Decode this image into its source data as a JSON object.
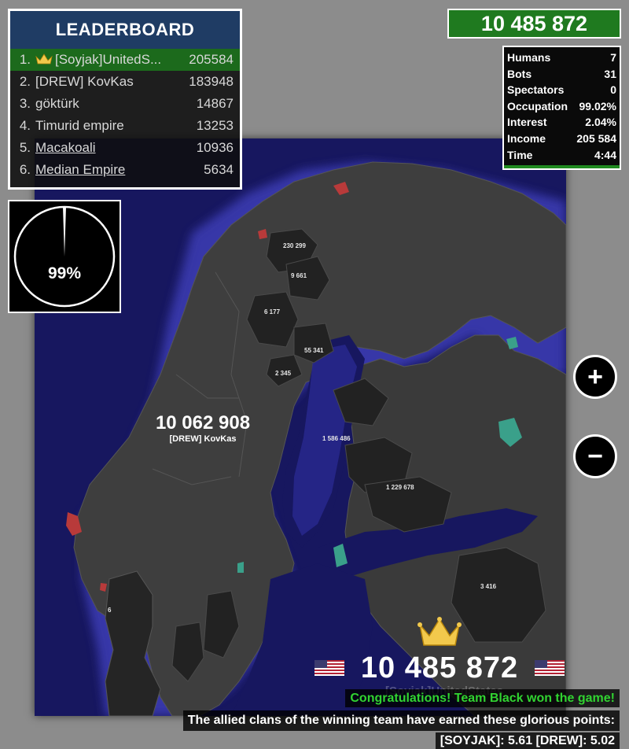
{
  "leaderboard": {
    "title": "LEADERBOARD",
    "rows": [
      {
        "rank": "1.",
        "name": "[Soyjak]UnitedS...",
        "score": "205584"
      },
      {
        "rank": "2.",
        "name": "[DREW] KovKas",
        "score": "183948"
      },
      {
        "rank": "3.",
        "name": "göktürk",
        "score": "14867"
      },
      {
        "rank": "4.",
        "name": "Timurid empire",
        "score": "13253"
      },
      {
        "rank": "5.",
        "name": "Macakoali",
        "score": "10936"
      },
      {
        "rank": "6.",
        "name": "Median Empire",
        "score": "5634"
      }
    ]
  },
  "occupation_pie": {
    "label": "99%",
    "fraction": 0.99
  },
  "total_score": "10 485 872",
  "stats": [
    {
      "label": "Humans",
      "value": "7"
    },
    {
      "label": "Bots",
      "value": "31"
    },
    {
      "label": "Spectators",
      "value": "0"
    },
    {
      "label": "Occupation",
      "value": "99.02%"
    },
    {
      "label": "Interest",
      "value": "2.04%"
    },
    {
      "label": "Income",
      "value": "205 584"
    },
    {
      "label": "Time",
      "value": "4:44"
    }
  ],
  "zoom": {
    "in_label": "+",
    "out_label": "−"
  },
  "map": {
    "territory_labels": [
      "230 299",
      "9 661",
      "6 177",
      "55 341",
      "2 345",
      "1 586 486",
      "1 229 678",
      "3 416",
      "6"
    ],
    "player_territory": {
      "score": "10 062 908",
      "name": "[DREW] KovKas"
    }
  },
  "winner": {
    "score": "10 485 872",
    "name_faded": "[Soyjak]UnitedStates",
    "message": "Congratulations! Team Black won the game!",
    "points_intro": "The allied clans of the winning team have earned these glorious points:",
    "points": "[SOYJAK]: 5.61   [DREW]: 5.02"
  },
  "colors": {
    "leaderboard_header": "#1f3c64",
    "leader_row": "#1c6a1c",
    "score_box": "#1f7a1f",
    "win_message": "#31d431",
    "sea": "#17175f",
    "land": "#3d3d3d"
  }
}
